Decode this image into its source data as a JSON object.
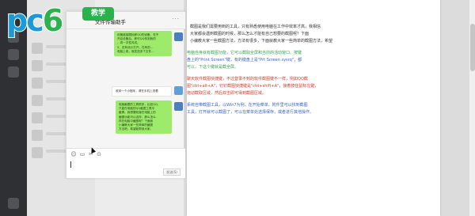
{
  "watermark": {
    "logo_text_pc": "pc",
    "logo_text_six": "6",
    "badge": "教学"
  },
  "chat": {
    "title": "文件传输助手",
    "more": "···",
    "messages": [
      {
        "side": "right",
        "style": "green",
        "lines": [
          "设备链接图标即QQ的设备，在不",
          "开启设备后，即可QQ传到我的",
          "，将一次性传送。",
          "2、还有设计打开，在有的…",
          "电脑上将，就发送多个文件…"
        ]
      },
      {
        "side": "right",
        "style": "white",
        "lines": [
          "收到一个小程序，请在手机上查看"
        ]
      },
      {
        "side": "right",
        "style": "green",
        "lines": [
          "电脑截图的工具很多，比如QQ，",
          "只能在电脑的QQ截图工具中",
          "截屏。我想要知道在电脑上的",
          "截图功能可以这样，那么怎么",
          "样在电脑中截图呢？下面我",
          "小编教大家一些简单的截图",
          "方法吧，希望能帮到大家。"
        ]
      }
    ],
    "toolbar": [
      "☺",
      "▭",
      "✂",
      "⊙"
    ],
    "send_label": "发送(S)"
  },
  "document": {
    "paragraphs": [
      {
        "style": "plain",
        "text": "截图是我们需要用到的工具，只有熟悉使用电脑在工作中效率才高，我相信"
      },
      {
        "style": "plain",
        "text": "大家都会遇到截图的时候，那么怎么才能有自己想要的截图呢？下面"
      },
      {
        "style": "plain",
        "text": "小编教大家一些截图方法，方法有很多，下面就教大家一些简单的截图方法，希望能帮助到"
      },
      {
        "style": "green",
        "text": "电脑自身就有截图功能，它可以截取全屏和当前的活动窗口。按键"
      },
      {
        "style": "blue",
        "text": "盘上的\"Print Screen\"键，有的键盘上是\"Prt Screen sysrq\"，都"
      },
      {
        "style": "green",
        "text": "可以，下这个键就是截全屏。"
      },
      {
        "style": "red",
        "text": "聊天软件截图快捷键，不过登录不到的软件截图键不一样，例如QQ截"
      },
      {
        "style": "red",
        "text": "图\"ctrl+alt+A\"，钉钉截图快捷键是\"ctrl+shift+A\"，接着按住鼠标左键，"
      },
      {
        "style": "red",
        "text": "拖动截取区域，然后双击即可得到截图区域。"
      },
      {
        "style": "blue",
        "text": "系统自带截图工具，以Win7为例，在开始菜单，附件里可以找到截图"
      },
      {
        "style": "blue",
        "text": "工具，打开就可以截图了，可以在菜单处选择保存，或者进行其他操作。"
      }
    ]
  },
  "colors": {
    "accent_green": "#9eea6a",
    "logo_blue": "#1b9ad6",
    "logo_green": "#2bb24c",
    "doc_red": "#d23b2b",
    "doc_blue": "#3b62c4",
    "doc_green": "#3aa055"
  }
}
